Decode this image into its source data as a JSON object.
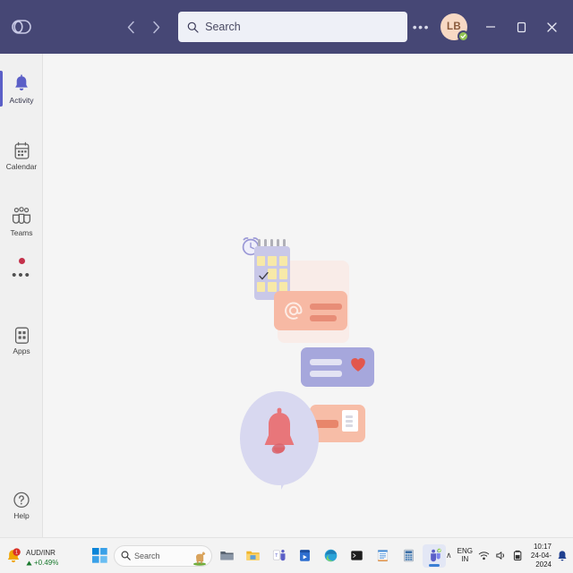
{
  "app": {
    "name": "Microsoft Teams",
    "logo_icon": "teams-logo-icon"
  },
  "titlebar": {
    "back_icon": "chevron-left-icon",
    "forward_icon": "chevron-right-icon",
    "search": {
      "placeholder": "Search",
      "value": "",
      "icon": "search-icon"
    },
    "more_label": "•••",
    "avatar": {
      "initials": "LB",
      "presence": "Available",
      "presence_icon": "check-circle-icon",
      "presence_color": "#92c353"
    },
    "minimize_label": "─",
    "restore_label": "❐",
    "close_label": "✕",
    "background_color": "#464775"
  },
  "rail": {
    "items": [
      {
        "label": "Activity",
        "icon": "bell-icon",
        "active": true
      },
      {
        "label": "Calendar",
        "icon": "calendar-icon",
        "active": false
      },
      {
        "label": "Teams",
        "icon": "teams-icon",
        "active": false
      }
    ],
    "more": {
      "label": "•••",
      "icon": "more-apps-icon",
      "badge": true,
      "badge_color": "#c4314b"
    },
    "apps": {
      "label": "Apps",
      "icon": "apps-grid-icon"
    },
    "help": {
      "label": "Help",
      "icon": "question-circle-icon"
    },
    "accent_color": "#5b5fc7",
    "background_color": "#f0f0f0"
  },
  "main": {
    "background_color": "#f5f5f5",
    "illustration": {
      "name": "activity-empty-state-illustration",
      "elements": [
        {
          "name": "alarm-clock-icon",
          "color": "#9a98d6"
        },
        {
          "name": "calendar-icon",
          "color": "#c9c8e8"
        },
        {
          "name": "mention-card",
          "color": "#f7b9a4",
          "icon": "at-symbol-icon"
        },
        {
          "name": "reaction-card",
          "color": "#a6a7dc",
          "icon": "heart-icon"
        },
        {
          "name": "document-card",
          "color": "#f7bda7",
          "icon": "document-icon"
        },
        {
          "name": "speech-bubble",
          "color": "#d8d8f0",
          "icon": "bell-icon"
        }
      ]
    }
  },
  "taskbar": {
    "widget": {
      "title": "AUD/INR",
      "change": "+0.49%",
      "trend_icon": "triangle-up-icon",
      "badge_icon": "notification-badge-icon",
      "badge_count": "1"
    },
    "start_label": "Start",
    "start_icon": "windows-logo-icon",
    "search": {
      "placeholder": "Search",
      "icon": "search-icon",
      "mascot_icon": "llama-icon"
    },
    "apps": [
      {
        "name": "file-explorer-icon",
        "active": false
      },
      {
        "name": "folder-icon",
        "active": false
      },
      {
        "name": "teams-personal-icon",
        "active": false
      },
      {
        "name": "microsoft-store-icon",
        "active": false
      },
      {
        "name": "microsoft-edge-icon",
        "active": false
      },
      {
        "name": "terminal-icon",
        "active": false
      },
      {
        "name": "notepad-icon",
        "active": false
      },
      {
        "name": "calculator-icon",
        "active": false
      },
      {
        "name": "microsoft-teams-icon",
        "active": true
      }
    ],
    "tray": {
      "overflow_label": "∧",
      "language": {
        "top": "ENG",
        "bottom": "IN"
      },
      "wifi_icon": "wifi-icon",
      "volume_icon": "speaker-icon",
      "battery_icon": "battery-icon",
      "time": "10:17",
      "date": "24-04-2024",
      "notification_icon": "bell-icon"
    }
  }
}
